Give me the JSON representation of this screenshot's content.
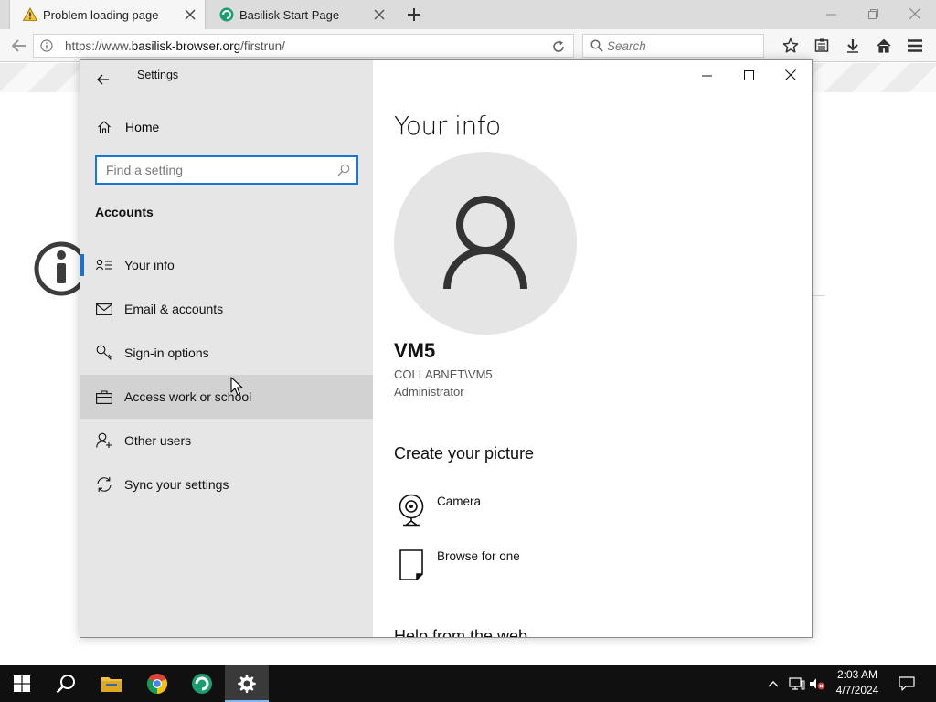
{
  "browser": {
    "tabs": [
      {
        "title": "Problem loading page",
        "active": true,
        "icon": "warning-icon"
      },
      {
        "title": "Basilisk Start Page",
        "active": false,
        "icon": "basilisk-icon"
      }
    ],
    "url_prefix": "https://www.",
    "url_domain": "basilisk-browser.org",
    "url_path": "/firstrun/",
    "search_placeholder": "Search"
  },
  "settings": {
    "window_title": "Settings",
    "home_label": "Home",
    "search_placeholder": "Find a setting",
    "section_heading": "Accounts",
    "nav_items": [
      {
        "label": "Your info",
        "icon": "contact-card-icon",
        "selected": true
      },
      {
        "label": "Email & accounts",
        "icon": "mail-icon"
      },
      {
        "label": "Sign-in options",
        "icon": "key-icon"
      },
      {
        "label": "Access work or school",
        "icon": "briefcase-icon",
        "hovered": true
      },
      {
        "label": "Other users",
        "icon": "add-person-icon"
      },
      {
        "label": "Sync your settings",
        "icon": "sync-icon"
      }
    ],
    "content": {
      "title": "Your info",
      "user_name": "VM5",
      "user_domain": "COLLABNET\\VM5",
      "user_role": "Administrator",
      "create_picture_heading": "Create your picture",
      "picture_options": [
        {
          "label": "Camera",
          "icon": "camera-icon"
        },
        {
          "label": "Browse for one",
          "icon": "browse-file-icon"
        }
      ],
      "cutoff_heading": "Help from the web"
    }
  },
  "taskbar": {
    "apps": [
      "start-icon",
      "search-icon",
      "file-explorer-icon",
      "chrome-icon",
      "basilisk-icon",
      "settings-gear-icon"
    ],
    "time": "2:03 AM",
    "date": "4/7/2024"
  },
  "colors": {
    "accent": "#1879d4",
    "sidebar_bg": "#e6e6e6",
    "taskbar_bg": "#101010"
  }
}
